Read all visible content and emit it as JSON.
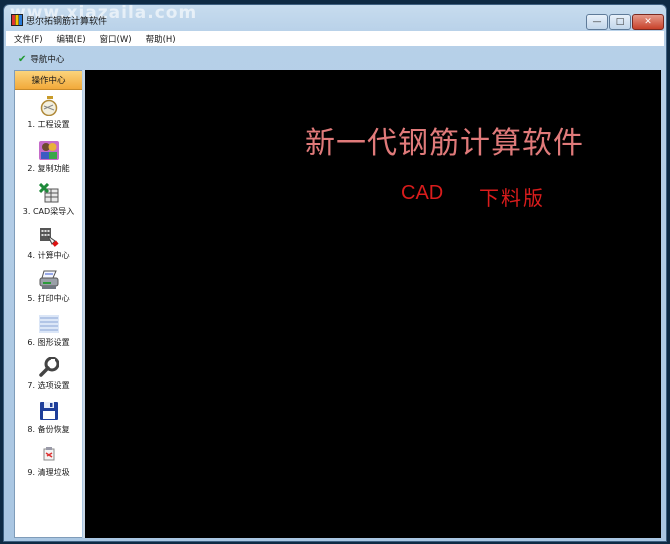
{
  "window": {
    "title": "思尔拓钢筋计算软件",
    "watermark": "www.xiazaila.com",
    "controls": {
      "minimize": "—",
      "maximize": "□",
      "close": "✕"
    }
  },
  "menubar": {
    "items": [
      {
        "label": "文件(F)"
      },
      {
        "label": "编辑(E)"
      },
      {
        "label": "窗口(W)"
      },
      {
        "label": "帮助(H)"
      }
    ]
  },
  "toolbar": {
    "nav_tab": {
      "icon": "check-icon",
      "label": "导航中心"
    }
  },
  "sidebar": {
    "header": "操作中心",
    "items": [
      {
        "label": "1. 工程设置",
        "icon": "stopwatch-icon"
      },
      {
        "label": "2. 复制功能",
        "icon": "users-icon"
      },
      {
        "label": "3. CAD梁导入",
        "icon": "excel-import-icon"
      },
      {
        "label": "4. 计算中心",
        "icon": "calculator-hand-icon"
      },
      {
        "label": "5. 打印中心",
        "icon": "printer-icon"
      },
      {
        "label": "6. 图形设置",
        "icon": "document-lines-icon"
      },
      {
        "label": "7. 选项设置",
        "icon": "wrench-icon"
      },
      {
        "label": "8. 备份恢复",
        "icon": "floppy-disk-icon"
      },
      {
        "label": "9. 清理垃圾",
        "icon": "cleanup-icon"
      }
    ]
  },
  "canvas": {
    "headline": "新一代钢筋计算软件",
    "sub_cad": "CAD",
    "sub_version": "下料版",
    "colors": {
      "background": "#000000",
      "headline": "#e07a7a",
      "subline": "#d91c1c"
    }
  }
}
